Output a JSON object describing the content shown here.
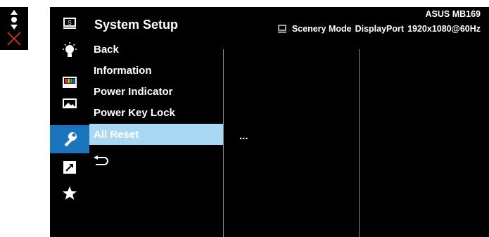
{
  "keypad": {
    "icons": [
      "navigation-icon",
      "close-icon"
    ]
  },
  "osd": {
    "title": "System Setup",
    "model": "ASUS MB169",
    "status": {
      "mode_icon": "monitor-icon",
      "mode": "Scenery Mode",
      "input": "DisplayPort",
      "resolution": "1920x1080@60Hz"
    },
    "sidebar": [
      {
        "icon": "splendid-icon"
      },
      {
        "icon": "bluelight-filter-icon"
      },
      {
        "icon": "color-icon"
      },
      {
        "icon": "image-icon"
      },
      {
        "icon": "system-setup-icon",
        "active": true
      },
      {
        "icon": "shortcut-icon"
      },
      {
        "icon": "favorite-icon"
      }
    ],
    "menu": [
      {
        "label": "Back"
      },
      {
        "label": "Information"
      },
      {
        "label": "Power Indicator"
      },
      {
        "label": "Power Key Lock"
      },
      {
        "label": "All Reset",
        "selected": true
      }
    ],
    "return_icon": "return-icon",
    "submenu_value": "...",
    "colors": {
      "background": "#000000",
      "active_tab": "#1b75bc",
      "selected_item": "#a8d8f4",
      "divider": "#8a8a8a"
    }
  }
}
